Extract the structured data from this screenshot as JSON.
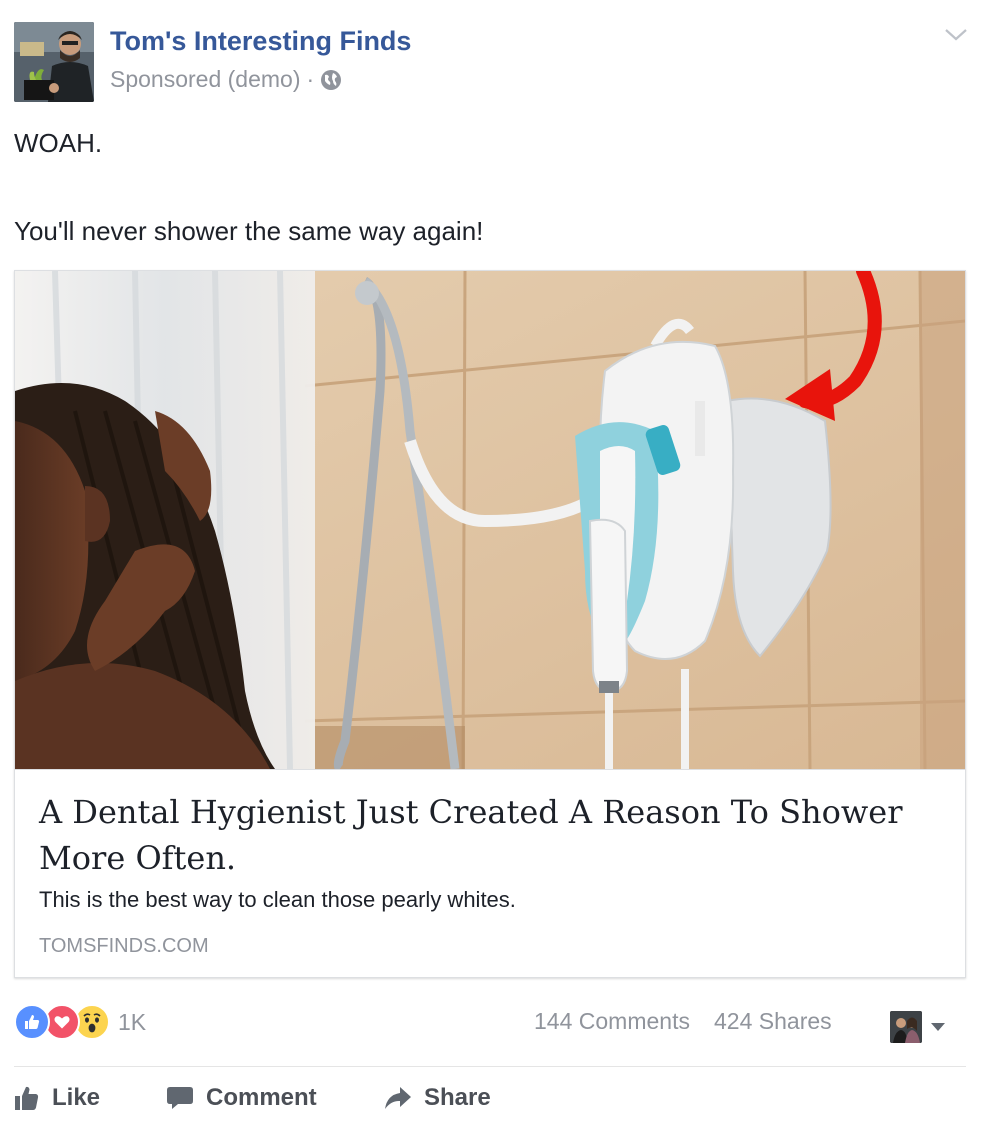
{
  "post": {
    "page_name": "Tom's Interesting Finds",
    "sponsored_label": "Sponsored (demo)",
    "separator": "·",
    "privacy_icon": "globe-icon",
    "menu_icon": "chevron-down-icon",
    "text_line_1": "WOAH.",
    "text_line_2": "You'll never shower the same way again!"
  },
  "link_card": {
    "title": "A Dental Hygienist Just Created A Reason To Shower More Often.",
    "description": "This is the best way to clean those pearly whites.",
    "domain": "TOMSFINDS.COM"
  },
  "stats": {
    "reaction_icons": [
      "like-reaction-icon",
      "love-reaction-icon",
      "wow-reaction-icon"
    ],
    "reaction_count": "1K",
    "comments": "144 Comments",
    "shares": "424 Shares"
  },
  "actions": {
    "like": "Like",
    "comment": "Comment",
    "share": "Share"
  },
  "colors": {
    "link_blue": "#365899",
    "meta_gray": "#90949c",
    "text": "#1d2129",
    "like_blue": "#5890ff",
    "love_red": "#f25268",
    "wow_yellow": "#fcd44f",
    "arrow_red": "#e8140c"
  }
}
